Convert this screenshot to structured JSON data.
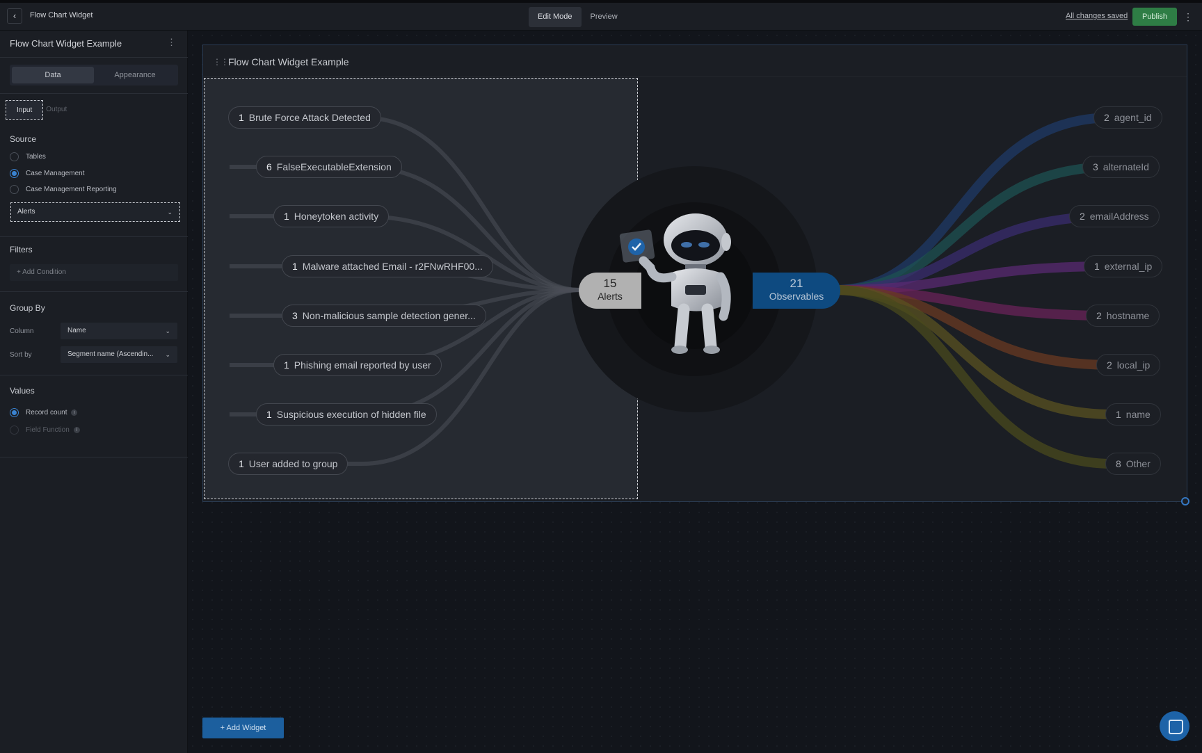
{
  "topbar": {
    "back_icon": "chevron-left-icon",
    "title": "Flow Chart Widget",
    "modes": [
      "Edit Mode",
      "Preview"
    ],
    "saved_text": "All changes saved",
    "publish_label": "Publish",
    "menu_icon": "kebab-icon"
  },
  "sidebar": {
    "title": "Flow Chart Widget Example",
    "tabs": [
      "Data",
      "Appearance"
    ],
    "io_tabs": [
      "Input",
      "Output"
    ],
    "source": {
      "title": "Source",
      "options": [
        "Tables",
        "Case Management",
        "Case Management Reporting"
      ],
      "selected": "Case Management",
      "dropdown_value": "Alerts"
    },
    "filters": {
      "title": "Filters",
      "add_label": "+ Add Condition"
    },
    "group_by": {
      "title": "Group By",
      "column_label": "Column",
      "column_value": "Name",
      "sort_label": "Sort by",
      "sort_value": "Segment name (Ascendin..."
    },
    "values": {
      "title": "Values",
      "options": [
        "Record count",
        "Field Function"
      ],
      "selected": "Record count"
    }
  },
  "widget": {
    "title": "Flow Chart Widget Example",
    "inputs": [
      {
        "count": "1",
        "label": "Brute Force Attack Detected"
      },
      {
        "count": "6",
        "label": "FalseExecutableExtension"
      },
      {
        "count": "1",
        "label": "Honeytoken activity"
      },
      {
        "count": "1",
        "label": "Malware attached Email - r2FNwRHF00..."
      },
      {
        "count": "3",
        "label": "Non-malicious sample detection gener..."
      },
      {
        "count": "1",
        "label": "Phishing email reported by user"
      },
      {
        "count": "1",
        "label": "Suspicious execution of hidden file"
      },
      {
        "count": "1",
        "label": "User added to group"
      }
    ],
    "hub_left": {
      "count": "15",
      "label": "Alerts"
    },
    "hub_right": {
      "count": "21",
      "label": "Observables"
    },
    "outputs": [
      {
        "count": "2",
        "label": "agent_id",
        "color": "#1f3a66"
      },
      {
        "count": "3",
        "label": "alternateId",
        "color": "#1d5252"
      },
      {
        "count": "2",
        "label": "emailAddress",
        "color": "#3a2c6e"
      },
      {
        "count": "1",
        "label": "external_ip",
        "color": "#5a2a72"
      },
      {
        "count": "2",
        "label": "hostname",
        "color": "#6a2358"
      },
      {
        "count": "2",
        "label": "local_ip",
        "color": "#6a3a22"
      },
      {
        "count": "1",
        "label": "name",
        "color": "#5a5120"
      },
      {
        "count": "8",
        "label": "Other",
        "color": "#4a4a1c"
      }
    ]
  },
  "canvas": {
    "add_widget_label": "+ Add Widget",
    "chat_icon": "chat-icon"
  }
}
